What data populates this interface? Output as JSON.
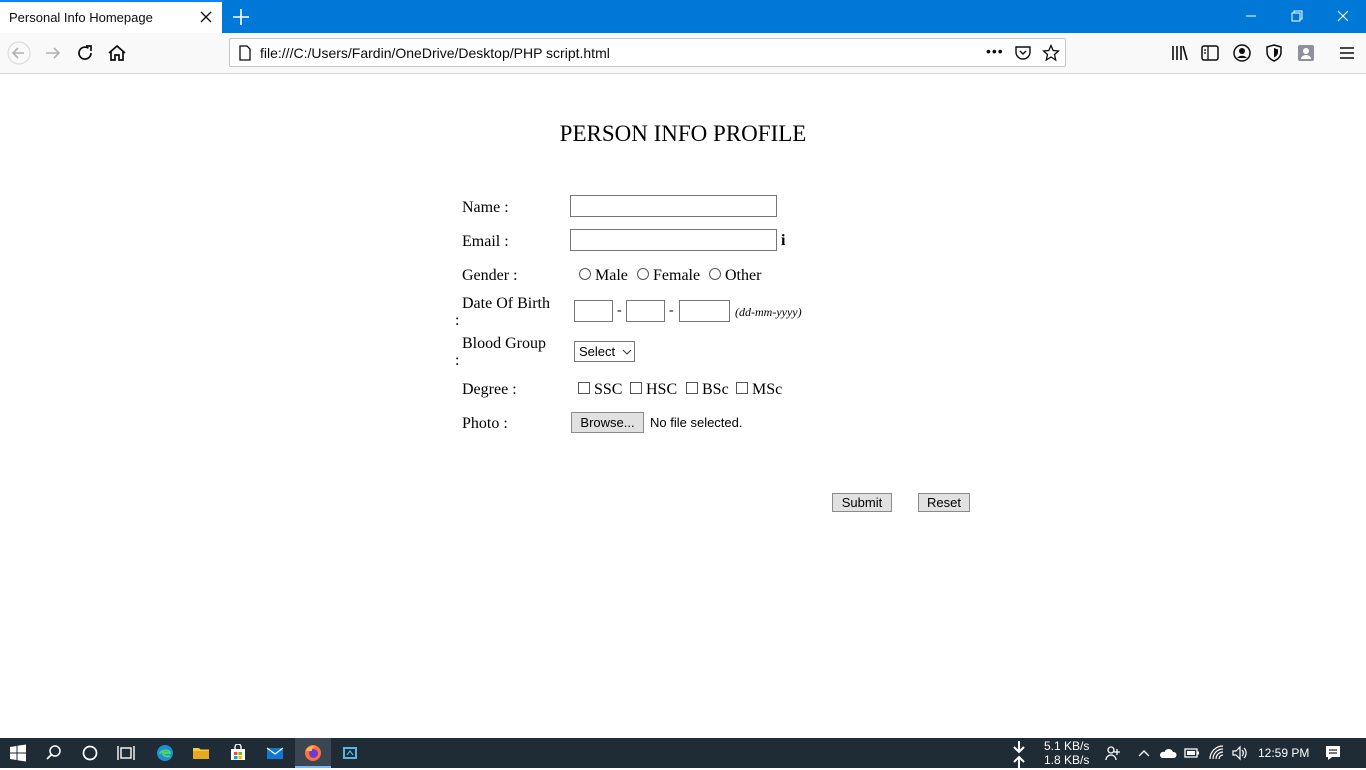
{
  "browser": {
    "tab_title": "Personal Info Homepage",
    "url": "file:///C:/Users/Fardin/OneDrive/Desktop/PHP script.html",
    "more_label": "•••"
  },
  "form": {
    "title": "PERSON INFO PROFILE",
    "name_label": "Name :",
    "email_label": "Email :",
    "email_info": "i",
    "gender_label": "Gender :",
    "gender_options": [
      "Male",
      "Female",
      "Other"
    ],
    "dob_label": "Date Of Birth",
    "dob_colon": ":",
    "dob_dash": "-",
    "dob_hint": "(dd-mm-yyyy)",
    "blood_label": "Blood Group",
    "blood_colon": ":",
    "blood_selected": "Select",
    "degree_label": "Degree :",
    "degree_options": [
      "SSC",
      "HSC",
      "BSc",
      "MSc"
    ],
    "photo_label": "Photo :",
    "browse_label": "Browse...",
    "no_file": "No file selected.",
    "submit_label": "Submit",
    "reset_label": "Reset"
  },
  "taskbar": {
    "net_down": "5.1 KB/s",
    "net_up": "1.8 KB/s",
    "time": "12:59 PM"
  },
  "colors": {
    "tabbar": "#0078d7",
    "taskbar": "#1f2b35"
  }
}
